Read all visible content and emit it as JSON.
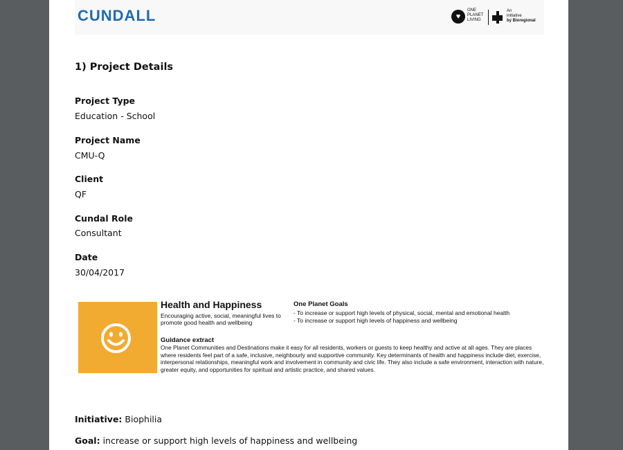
{
  "header": {
    "brand": "CUNDALL",
    "opl_text": [
      "ONE",
      "PLANET",
      "LIVING"
    ],
    "initiative_text": [
      "An",
      "initiative",
      "by Bioregional"
    ]
  },
  "section_title": "1) Project Details",
  "fields": [
    {
      "label": "Project Type",
      "value": "Education - School"
    },
    {
      "label": "Project Name",
      "value": "CMU-Q"
    },
    {
      "label": "Client",
      "value": "QF"
    },
    {
      "label": "Cundal Role",
      "value": "Consultant"
    },
    {
      "label": "Date",
      "value": "30/04/2017"
    }
  ],
  "principle": {
    "title": "Health and Happiness",
    "subtitle": "Encouraging active, social, meaningful lives to promote good health and wellbeing",
    "goals_title": "One Planet Goals",
    "goals": [
      "- To increase or support high levels of physical, social, mental and emotional health",
      "- To increase or support high levels of happiness and wellbeing"
    ],
    "guidance_title": "Guidance extract",
    "guidance_text": "One Planet Communities and Destinations make it easy for all residents, workers or guests to keep healthy and active at all ages. They are places where residents feel part of a safe, inclusive, neighbourly and supportive community. Key determinants of health and happiness include diet, exercise, interpersonal relationships, meaningful work and involvement in community and civic life. They also include a safe environment, interaction with nature, greater equity, and opportunities for spiritual and artistic practice, and shared values.",
    "box_color": "#f1ab31"
  },
  "initiative": {
    "label": "Initiative:",
    "value": "Biophilia"
  },
  "goal": {
    "label": "Goal:",
    "value": "increase or support high levels of happiness and wellbeing"
  },
  "colors": {
    "brand": "#1f6bb0",
    "background": "#5a5d5f"
  }
}
